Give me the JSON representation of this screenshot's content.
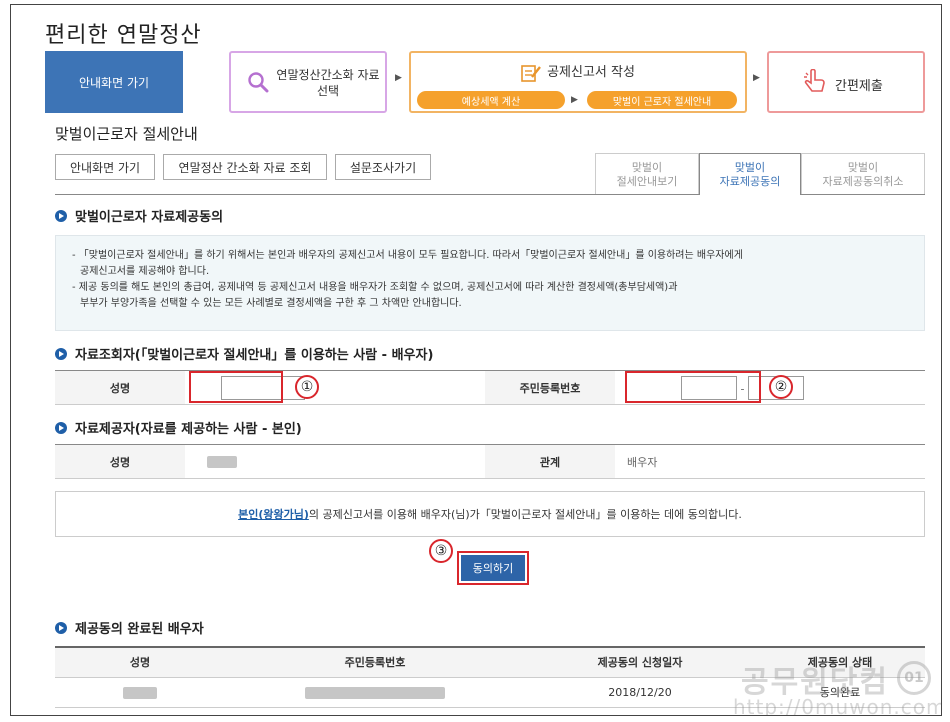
{
  "app_title": "편리한 연말정산",
  "steps": {
    "home": "안내화면 가기",
    "step1": "연말정산간소화 자료선택",
    "step2": "공제신고서 작성",
    "step2_sub_a": "예상세액 계산",
    "step2_sub_b": "맞벌이 근로자 절세안내",
    "step3": "간편제출"
  },
  "page_title": "맞벌이근로자 절세안내",
  "buttons": {
    "home": "안내화면 가기",
    "lookup": "연말정산 간소화 자료 조회",
    "survey": "설문조사가기",
    "agree": "동의하기"
  },
  "tabs": [
    {
      "line1": "맞벌이",
      "line2": "절세안내보기"
    },
    {
      "line1": "맞벌이",
      "line2": "자료제공동의"
    },
    {
      "line1": "맞벌이",
      "line2": "자료제공동의취소"
    }
  ],
  "sections": {
    "consent": "맞벌이근로자 자료제공동의",
    "viewer": "자료조회자(「맞벌이근로자 절세안내」를 이용하는 사람 - 배우자)",
    "provider": "자료제공자(자료를 제공하는 사람 - 본인)",
    "completed": "제공동의 완료된 배우자"
  },
  "notice": {
    "line1": "- 「맞벌이근로자 절세안내」를 하기 위해서는 본인과 배우자의 공제신고서 내용이 모두 필요합니다. 따라서「맞벌이근로자 절세안내」를 이용하려는 배우자에게",
    "line2": "공제신고서를 제공해야 합니다.",
    "line3": "- 제공 동의를 해도 본인의 총급여, 공제내역 등 공제신고서 내용을 배우자가 조회할 수 없으며, 공제신고서에 따라 계산한 결정세액(총부담세액)과",
    "line4": "부부가 부양가족을 선택할 수 있는 모든 사례별로 결정세액을 구한 후 그 차액만 안내합니다."
  },
  "viewer_form": {
    "name_label": "성명",
    "rrn_label": "주민등록번호",
    "dash": "-"
  },
  "provider_form": {
    "name_label": "성명",
    "relation_label": "관계",
    "relation_value": "배우자"
  },
  "agree_text": {
    "link": "본인(왕왕가님)",
    "rest": "의 공제신고서를 이용해 배우자(님)가「맞벌이근로자 절세안내」를 이용하는 데에 동의합니다."
  },
  "markers": [
    "①",
    "②",
    "③"
  ],
  "completed_table": {
    "headers": [
      "성명",
      "주민등록번호",
      "제공동의 신청일자",
      "제공동의 상태"
    ],
    "rows": [
      {
        "date": "2018/12/20",
        "status": "동의완료"
      }
    ]
  },
  "watermark": {
    "text": "공무원닷컴",
    "url": "http://0muwon.com",
    "badge": "01"
  },
  "colors": {
    "primary": "#3d74b6",
    "highlight": "#d9262c",
    "step1_border": "#d7a6e6",
    "step2_border": "#f2b463",
    "step3_border": "#ee9a9a",
    "pill": "#f5a12c"
  }
}
